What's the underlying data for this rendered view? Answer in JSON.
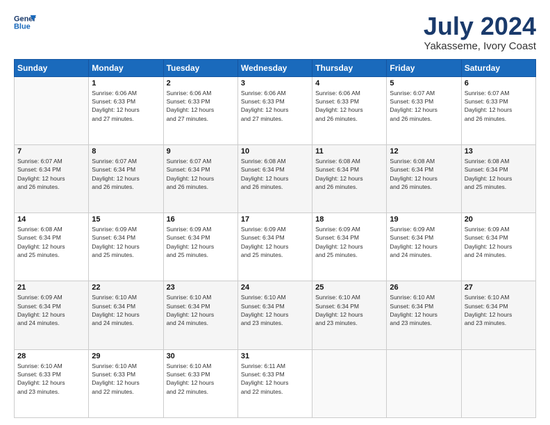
{
  "header": {
    "logo_line1": "General",
    "logo_line2": "Blue",
    "title": "July 2024",
    "subtitle": "Yakasseme, Ivory Coast"
  },
  "weekdays": [
    "Sunday",
    "Monday",
    "Tuesday",
    "Wednesday",
    "Thursday",
    "Friday",
    "Saturday"
  ],
  "weeks": [
    [
      {
        "day": "",
        "info": ""
      },
      {
        "day": "1",
        "info": "Sunrise: 6:06 AM\nSunset: 6:33 PM\nDaylight: 12 hours\nand 27 minutes."
      },
      {
        "day": "2",
        "info": "Sunrise: 6:06 AM\nSunset: 6:33 PM\nDaylight: 12 hours\nand 27 minutes."
      },
      {
        "day": "3",
        "info": "Sunrise: 6:06 AM\nSunset: 6:33 PM\nDaylight: 12 hours\nand 27 minutes."
      },
      {
        "day": "4",
        "info": "Sunrise: 6:06 AM\nSunset: 6:33 PM\nDaylight: 12 hours\nand 26 minutes."
      },
      {
        "day": "5",
        "info": "Sunrise: 6:07 AM\nSunset: 6:33 PM\nDaylight: 12 hours\nand 26 minutes."
      },
      {
        "day": "6",
        "info": "Sunrise: 6:07 AM\nSunset: 6:33 PM\nDaylight: 12 hours\nand 26 minutes."
      }
    ],
    [
      {
        "day": "7",
        "info": "Sunrise: 6:07 AM\nSunset: 6:34 PM\nDaylight: 12 hours\nand 26 minutes."
      },
      {
        "day": "8",
        "info": "Sunrise: 6:07 AM\nSunset: 6:34 PM\nDaylight: 12 hours\nand 26 minutes."
      },
      {
        "day": "9",
        "info": "Sunrise: 6:07 AM\nSunset: 6:34 PM\nDaylight: 12 hours\nand 26 minutes."
      },
      {
        "day": "10",
        "info": "Sunrise: 6:08 AM\nSunset: 6:34 PM\nDaylight: 12 hours\nand 26 minutes."
      },
      {
        "day": "11",
        "info": "Sunrise: 6:08 AM\nSunset: 6:34 PM\nDaylight: 12 hours\nand 26 minutes."
      },
      {
        "day": "12",
        "info": "Sunrise: 6:08 AM\nSunset: 6:34 PM\nDaylight: 12 hours\nand 26 minutes."
      },
      {
        "day": "13",
        "info": "Sunrise: 6:08 AM\nSunset: 6:34 PM\nDaylight: 12 hours\nand 25 minutes."
      }
    ],
    [
      {
        "day": "14",
        "info": "Sunrise: 6:08 AM\nSunset: 6:34 PM\nDaylight: 12 hours\nand 25 minutes."
      },
      {
        "day": "15",
        "info": "Sunrise: 6:09 AM\nSunset: 6:34 PM\nDaylight: 12 hours\nand 25 minutes."
      },
      {
        "day": "16",
        "info": "Sunrise: 6:09 AM\nSunset: 6:34 PM\nDaylight: 12 hours\nand 25 minutes."
      },
      {
        "day": "17",
        "info": "Sunrise: 6:09 AM\nSunset: 6:34 PM\nDaylight: 12 hours\nand 25 minutes."
      },
      {
        "day": "18",
        "info": "Sunrise: 6:09 AM\nSunset: 6:34 PM\nDaylight: 12 hours\nand 25 minutes."
      },
      {
        "day": "19",
        "info": "Sunrise: 6:09 AM\nSunset: 6:34 PM\nDaylight: 12 hours\nand 24 minutes."
      },
      {
        "day": "20",
        "info": "Sunrise: 6:09 AM\nSunset: 6:34 PM\nDaylight: 12 hours\nand 24 minutes."
      }
    ],
    [
      {
        "day": "21",
        "info": "Sunrise: 6:09 AM\nSunset: 6:34 PM\nDaylight: 12 hours\nand 24 minutes."
      },
      {
        "day": "22",
        "info": "Sunrise: 6:10 AM\nSunset: 6:34 PM\nDaylight: 12 hours\nand 24 minutes."
      },
      {
        "day": "23",
        "info": "Sunrise: 6:10 AM\nSunset: 6:34 PM\nDaylight: 12 hours\nand 24 minutes."
      },
      {
        "day": "24",
        "info": "Sunrise: 6:10 AM\nSunset: 6:34 PM\nDaylight: 12 hours\nand 23 minutes."
      },
      {
        "day": "25",
        "info": "Sunrise: 6:10 AM\nSunset: 6:34 PM\nDaylight: 12 hours\nand 23 minutes."
      },
      {
        "day": "26",
        "info": "Sunrise: 6:10 AM\nSunset: 6:34 PM\nDaylight: 12 hours\nand 23 minutes."
      },
      {
        "day": "27",
        "info": "Sunrise: 6:10 AM\nSunset: 6:34 PM\nDaylight: 12 hours\nand 23 minutes."
      }
    ],
    [
      {
        "day": "28",
        "info": "Sunrise: 6:10 AM\nSunset: 6:33 PM\nDaylight: 12 hours\nand 23 minutes."
      },
      {
        "day": "29",
        "info": "Sunrise: 6:10 AM\nSunset: 6:33 PM\nDaylight: 12 hours\nand 22 minutes."
      },
      {
        "day": "30",
        "info": "Sunrise: 6:10 AM\nSunset: 6:33 PM\nDaylight: 12 hours\nand 22 minutes."
      },
      {
        "day": "31",
        "info": "Sunrise: 6:11 AM\nSunset: 6:33 PM\nDaylight: 12 hours\nand 22 minutes."
      },
      {
        "day": "",
        "info": ""
      },
      {
        "day": "",
        "info": ""
      },
      {
        "day": "",
        "info": ""
      }
    ]
  ]
}
